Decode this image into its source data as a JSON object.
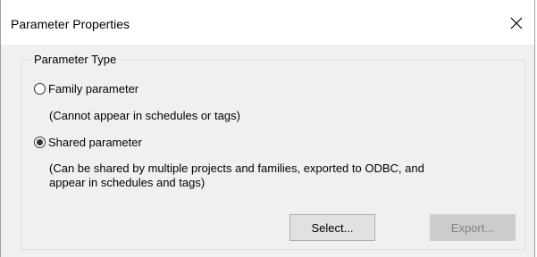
{
  "window": {
    "title": "Parameter Properties",
    "close_icon": "close-icon"
  },
  "parameter_type": {
    "group_label": "Parameter Type",
    "options": [
      {
        "label": "Family parameter",
        "selected": false,
        "description": [
          "(Cannot appear in schedules or tags)"
        ]
      },
      {
        "label": "Shared parameter",
        "selected": true,
        "description": [
          "(Can be shared by multiple projects and families, exported to ODBC, and",
          "appear in schedules and tags)"
        ]
      }
    ]
  },
  "buttons": {
    "select_label": "Select...",
    "export_label": "Export...",
    "export_enabled": false
  }
}
